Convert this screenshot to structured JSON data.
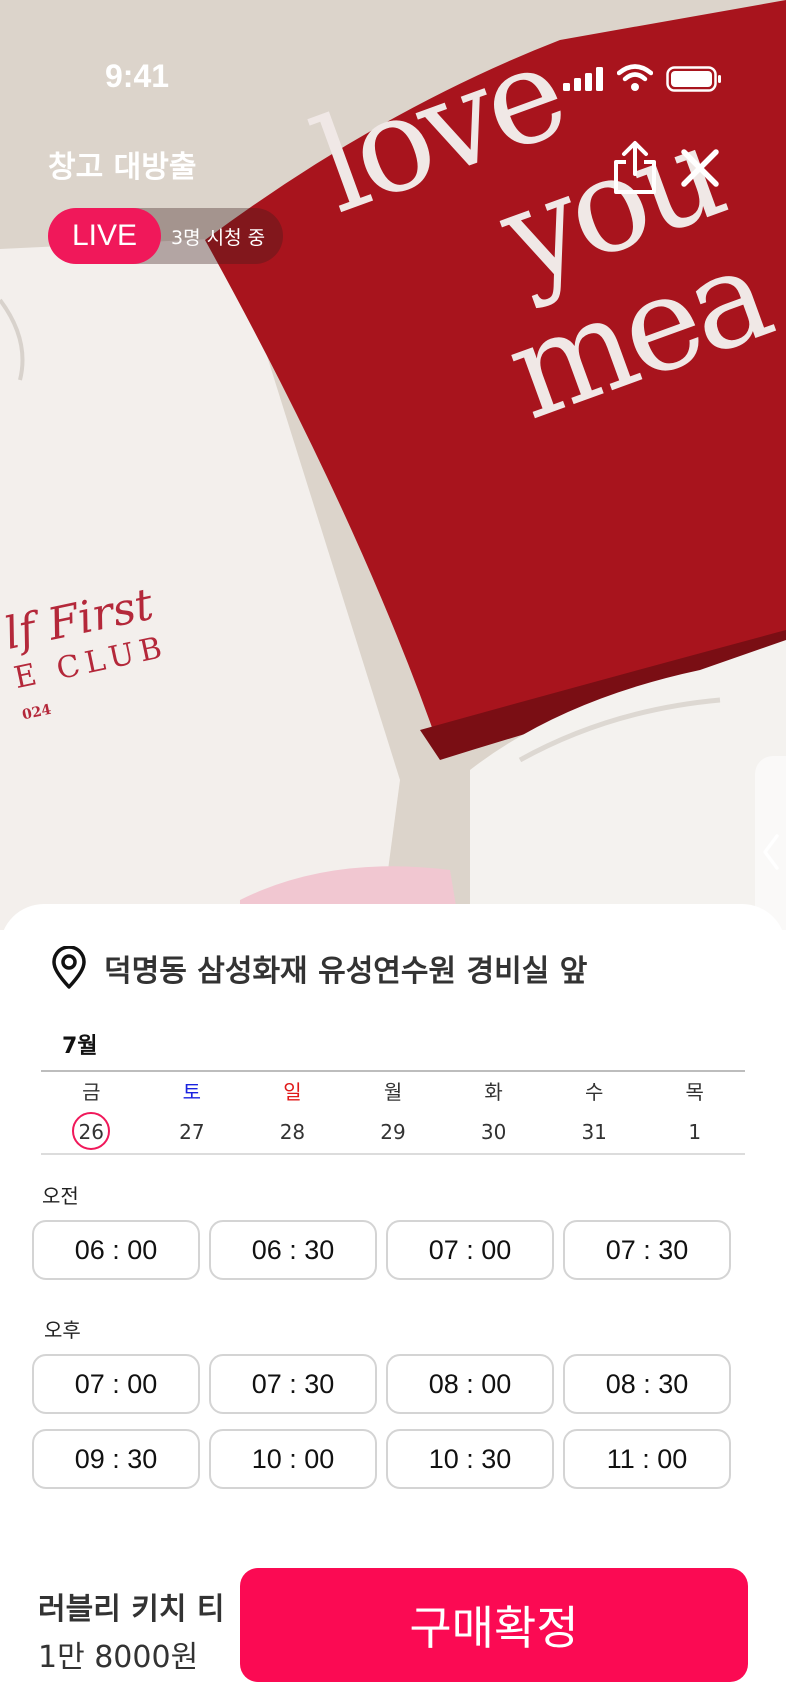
{
  "status_bar": {
    "time": "9:41"
  },
  "header": {
    "title": "창고 대방출",
    "live_label": "LIVE",
    "viewers_text": "3명 시청 중"
  },
  "photo": {
    "shirt_text_lines": [
      "love",
      "you",
      "mea"
    ],
    "white_shirt_text": [
      "lf First",
      "E CLUB",
      "024"
    ]
  },
  "location": {
    "text": "덕명동 삼성화재 유성연수원 경비실 앞"
  },
  "calendar": {
    "month": "7월",
    "days": [
      {
        "dow": "금",
        "date": "26",
        "selected": true
      },
      {
        "dow": "토",
        "date": "27"
      },
      {
        "dow": "일",
        "date": "28"
      },
      {
        "dow": "월",
        "date": "29"
      },
      {
        "dow": "화",
        "date": "30"
      },
      {
        "dow": "수",
        "date": "31"
      },
      {
        "dow": "목",
        "date": "1"
      }
    ]
  },
  "morning": {
    "label": "오전",
    "slots": [
      "06 : 00",
      "06 : 30",
      "07 : 00",
      "07 : 30"
    ]
  },
  "afternoon": {
    "label": "오후",
    "slots": [
      "07 : 00",
      "07 : 30",
      "08 : 00",
      "08 : 30",
      "09 : 30",
      "10 : 00",
      "10 : 30",
      "11 : 00"
    ]
  },
  "product": {
    "name": "러블리 키치 티",
    "price": "1만 8000원"
  },
  "buy_button": {
    "label": "구매확정"
  },
  "colors": {
    "accent": "#fb0a53",
    "live": "#f0185a",
    "saturday": "#1a23e0",
    "sunday": "#e01a1a"
  }
}
